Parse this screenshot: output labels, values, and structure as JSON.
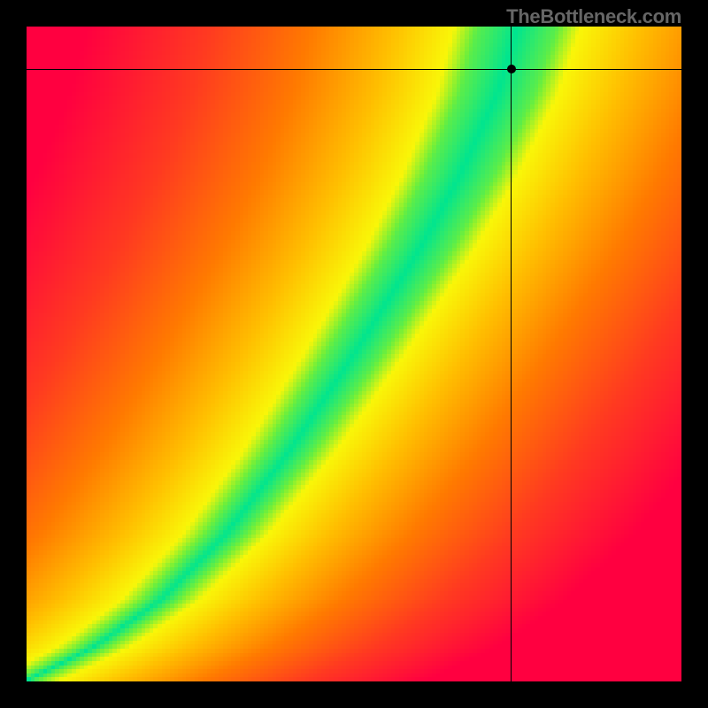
{
  "watermark": "TheBottleneck.com",
  "chart_data": {
    "type": "heatmap",
    "title": "",
    "xlabel": "",
    "ylabel": "",
    "xlim": [
      0,
      1
    ],
    "ylim": [
      0,
      1
    ],
    "ridge": [
      {
        "x": 0.0,
        "y": 0.0
      },
      {
        "x": 0.1,
        "y": 0.05
      },
      {
        "x": 0.2,
        "y": 0.12
      },
      {
        "x": 0.3,
        "y": 0.22
      },
      {
        "x": 0.4,
        "y": 0.35
      },
      {
        "x": 0.5,
        "y": 0.5
      },
      {
        "x": 0.6,
        "y": 0.66
      },
      {
        "x": 0.66,
        "y": 0.77
      },
      {
        "x": 0.72,
        "y": 0.9
      },
      {
        "x": 0.75,
        "y": 1.0
      }
    ],
    "marker": {
      "x": 0.74,
      "y": 0.935
    },
    "crosshair": {
      "x": 0.74,
      "y": 0.935
    },
    "colorscale": {
      "stops": [
        {
          "d": 0.0,
          "color": "#00e58f"
        },
        {
          "d": 0.05,
          "color": "#70ef3a"
        },
        {
          "d": 0.1,
          "color": "#f9f608"
        },
        {
          "d": 0.25,
          "color": "#ffbe00"
        },
        {
          "d": 0.45,
          "color": "#ff7a00"
        },
        {
          "d": 0.7,
          "color": "#ff3a20"
        },
        {
          "d": 1.0,
          "color": "#ff0040"
        }
      ]
    },
    "grid": false,
    "legend": false,
    "resolution": 160
  }
}
